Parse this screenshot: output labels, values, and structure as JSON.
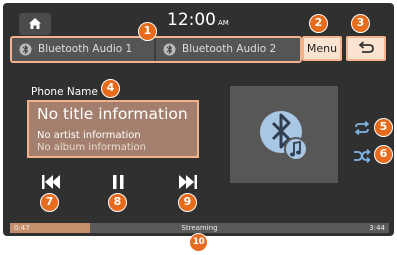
{
  "header": {
    "time": "12:00",
    "ampm": "AM"
  },
  "sources": [
    {
      "label": "Bluetooth Audio 1",
      "icon": "bluetooth-audio-icon"
    },
    {
      "label": "Bluetooth Audio 2",
      "icon": "bluetooth-audio-icon"
    }
  ],
  "toolbar": {
    "menu_label": "Menu",
    "back_icon": "back-arrow-icon",
    "home_icon": "home-icon"
  },
  "track": {
    "phone_name": "Phone Name",
    "title": "No title information",
    "artist": "No artist information",
    "album": "No album information"
  },
  "progress": {
    "elapsed": "0:47",
    "total": "3:44",
    "status": "Streaming",
    "fraction": 0.21
  },
  "callouts": [
    "1",
    "2",
    "3",
    "4",
    "5",
    "6",
    "7",
    "8",
    "9",
    "10"
  ],
  "colors": {
    "callout": "#e76b1d",
    "highlight_border": "#f3b38d",
    "screen_bg": "#303030",
    "info_bg": "#a57f6d"
  }
}
